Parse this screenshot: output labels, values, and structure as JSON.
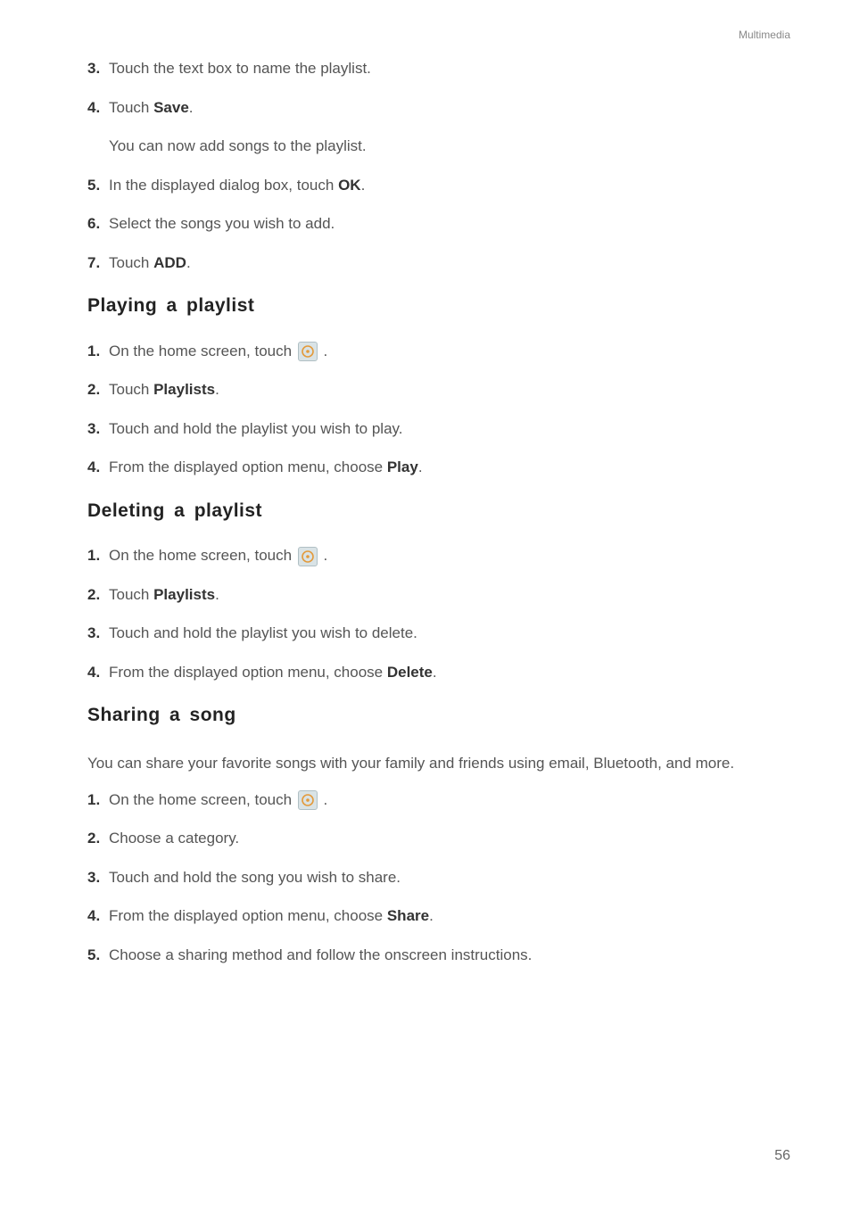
{
  "header": {
    "section": "Multimedia"
  },
  "intro_steps": [
    {
      "num": "3.",
      "text": "Touch the text box to name the playlist."
    },
    {
      "num": "4.",
      "text_prefix": "Touch ",
      "bold": "Save",
      "text_suffix": ".",
      "sub": "You can now add songs to the playlist."
    },
    {
      "num": "5.",
      "text_prefix": "In the displayed dialog box, touch ",
      "bold": "OK",
      "text_suffix": "."
    },
    {
      "num": "6.",
      "text": "Select the songs you wish to add."
    },
    {
      "num": "7.",
      "text_prefix": "Touch ",
      "bold": "ADD",
      "text_suffix": "."
    }
  ],
  "playing": {
    "heading": "Playing a playlist",
    "steps": [
      {
        "num": "1.",
        "text_prefix": "On the home screen, touch ",
        "icon": true,
        "text_suffix": "."
      },
      {
        "num": "2.",
        "text_prefix": "Touch ",
        "bold": "Playlists",
        "text_suffix": "."
      },
      {
        "num": "3.",
        "text": "Touch and hold the playlist you wish to play."
      },
      {
        "num": "4.",
        "text_prefix": "From the displayed option menu, choose ",
        "bold": "Play",
        "text_suffix": "."
      }
    ]
  },
  "deleting": {
    "heading": "Deleting a playlist",
    "steps": [
      {
        "num": "1.",
        "text_prefix": "On the home screen, touch ",
        "icon": true,
        "text_suffix": "."
      },
      {
        "num": "2.",
        "text_prefix": "Touch ",
        "bold": "Playlists",
        "text_suffix": "."
      },
      {
        "num": "3.",
        "text": "Touch and hold the playlist you wish to delete."
      },
      {
        "num": "4.",
        "text_prefix": "From the displayed option menu, choose ",
        "bold": "Delete",
        "text_suffix": "."
      }
    ]
  },
  "sharing": {
    "heading": "Sharing a song",
    "intro": "You can share your favorite songs with your family and friends using email, Bluetooth, and more.",
    "steps": [
      {
        "num": "1.",
        "text_prefix": "On the home screen, touch ",
        "icon": true,
        "text_suffix": "."
      },
      {
        "num": "2.",
        "text": "Choose a category."
      },
      {
        "num": "3.",
        "text": "Touch and hold the song you wish to share."
      },
      {
        "num": "4.",
        "text_prefix": "From the displayed option menu, choose ",
        "bold": "Share",
        "text_suffix": "."
      },
      {
        "num": "5.",
        "text": "Choose a sharing method and follow the onscreen instructions."
      }
    ]
  },
  "page_number": "56"
}
